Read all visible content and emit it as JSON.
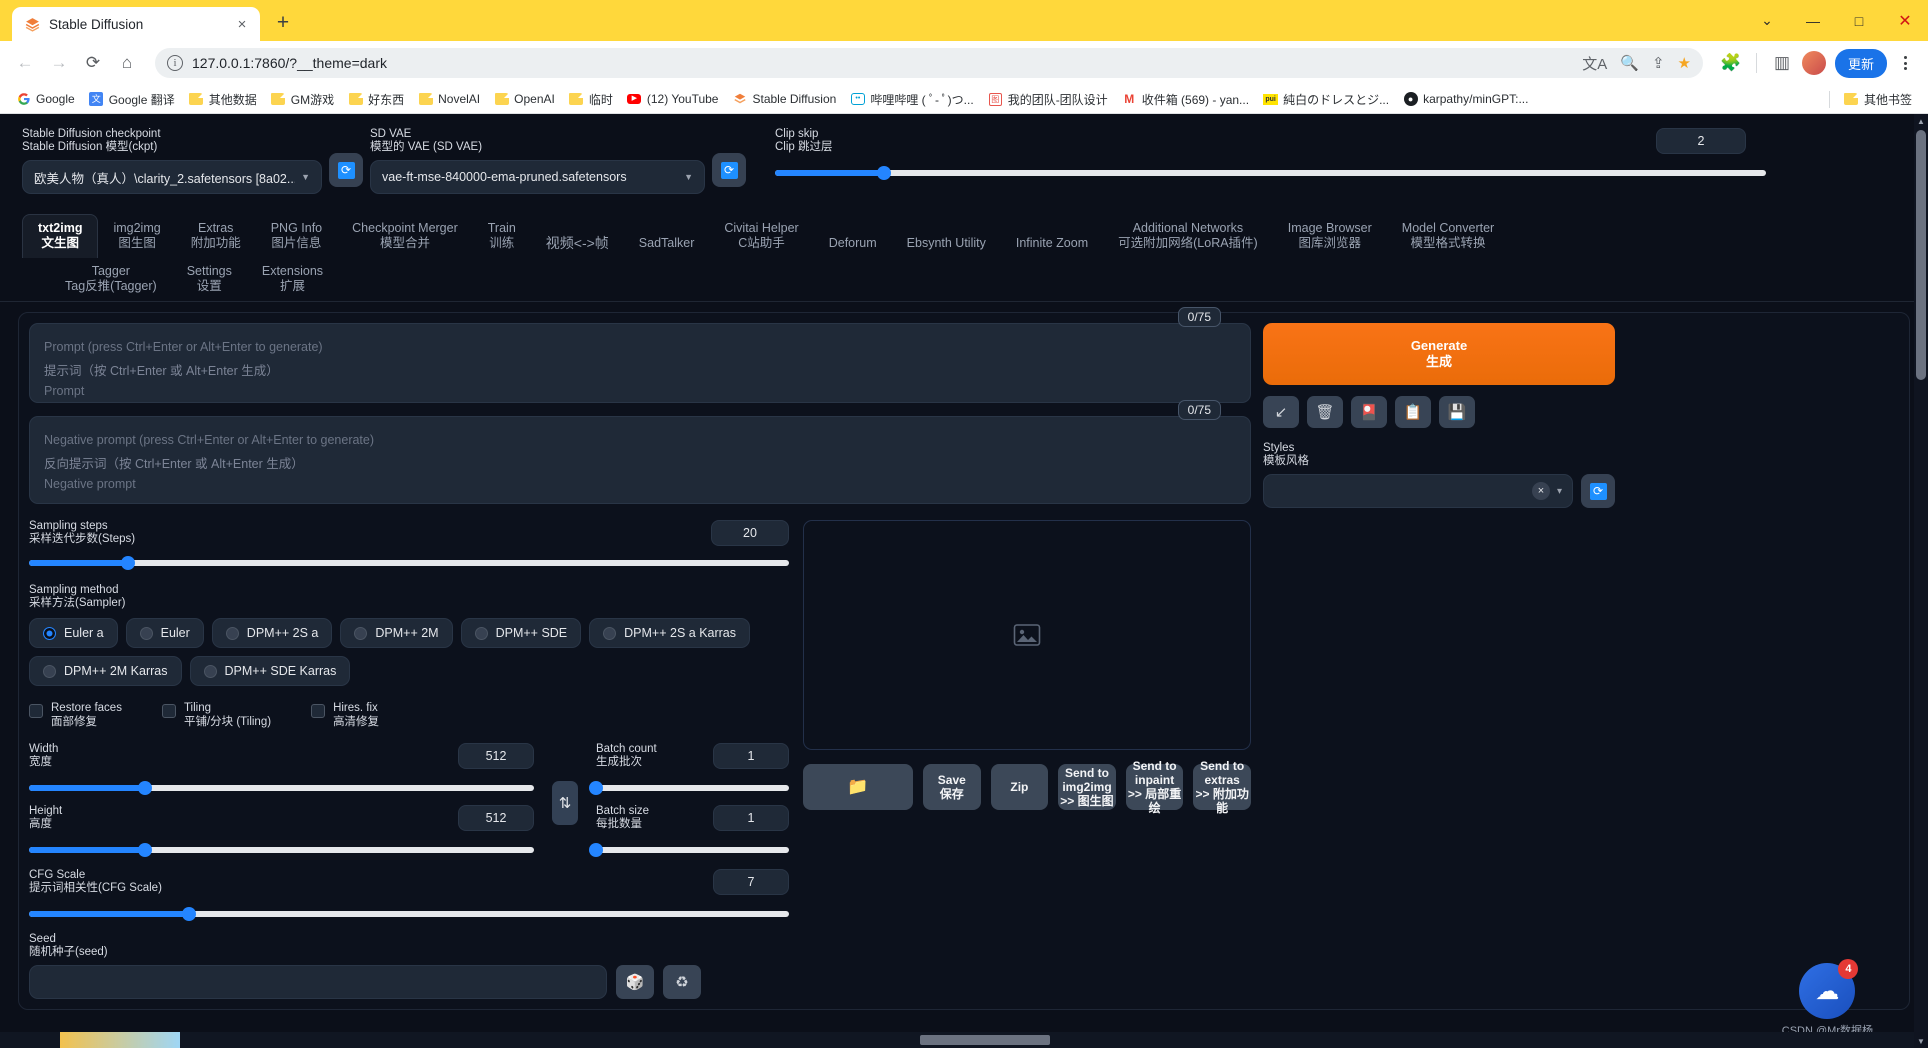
{
  "browser": {
    "tab": {
      "title": "Stable Diffusion",
      "favicon": "stable-diffusion-icon",
      "close": "×"
    },
    "newtab": "+",
    "window": {
      "minimize": "—",
      "maximize": "□",
      "restore": "⌄",
      "close": "✕"
    },
    "nav": {
      "back": "←",
      "forward": "→",
      "reload": "⟳",
      "home": "⌂"
    },
    "omnibox": {
      "url": "127.0.0.1:7860/?__theme=dark",
      "info_icon": "i",
      "translate_icon": "translate-icon",
      "zoom_icon": "zoom-icon",
      "share_icon": "share-icon",
      "star_icon": "★"
    },
    "navright": {
      "extensions": "extensions-icon",
      "sidepanel": "side-panel-icon",
      "profile": "avatar",
      "update_label": "更新",
      "menu": "kebab-menu-icon"
    },
    "bookmarks": [
      {
        "label": "Google",
        "icon": "google-icon"
      },
      {
        "label": "Google 翻译",
        "icon": "google-translate-icon"
      },
      {
        "label": "其他数据",
        "icon": "folder-icon"
      },
      {
        "label": "GM游戏",
        "icon": "folder-icon"
      },
      {
        "label": "好东西",
        "icon": "folder-icon"
      },
      {
        "label": "NovelAI",
        "icon": "folder-icon"
      },
      {
        "label": "OpenAI",
        "icon": "folder-icon"
      },
      {
        "label": "临时",
        "icon": "folder-icon"
      },
      {
        "label": "(12) YouTube",
        "icon": "youtube-icon"
      },
      {
        "label": "Stable Diffusion",
        "icon": "stable-diffusion-icon"
      },
      {
        "label": "哔哩哔哩 ( ﾟ- ﾟ)つ...",
        "icon": "bilibili-icon"
      },
      {
        "label": "我的团队-团队设计",
        "icon": "design-icon"
      },
      {
        "label": "收件箱 (569) - yan...",
        "icon": "gmail-icon"
      },
      {
        "label": "純白のドレスとジ...",
        "icon": "pixiv-icon"
      },
      {
        "label": "karpathy/minGPT:...",
        "icon": "github-icon"
      }
    ],
    "bookmarks_other": {
      "label": "其他书签",
      "icon": "folder-icon"
    }
  },
  "topbar": {
    "checkpoint": {
      "label_en": "Stable Diffusion checkpoint",
      "label_cn": "Stable Diffusion 模型(ckpt)",
      "value": "欧美人物（真人）\\clarity_2.safetensors [8a02...",
      "refresh_icon": "refresh-icon"
    },
    "vae": {
      "label_en": "SD VAE",
      "label_cn": "模型的 VAE (SD VAE)",
      "value": "vae-ft-mse-840000-ema-pruned.safetensors",
      "refresh_icon": "refresh-icon"
    },
    "clip_skip": {
      "label_en": "Clip skip",
      "label_cn": "Clip 跳过层",
      "value": "2",
      "min": 1,
      "max": 12,
      "percent": 11
    }
  },
  "tabs_row1": [
    {
      "en": "txt2img",
      "cn": "文生图",
      "active": true
    },
    {
      "en": "img2img",
      "cn": "图生图",
      "active": false
    },
    {
      "en": "Extras",
      "cn": "附加功能",
      "active": false
    },
    {
      "en": "PNG Info",
      "cn": "图片信息",
      "active": false
    },
    {
      "en": "Checkpoint Merger",
      "cn": "模型合并",
      "active": false
    },
    {
      "en": "Train",
      "cn": "训练",
      "active": false
    },
    {
      "en": "视频<->帧",
      "cn": "",
      "active": false
    },
    {
      "en": "SadTalker",
      "cn": "",
      "active": false
    },
    {
      "en": "Civitai Helper",
      "cn": "C站助手",
      "active": false
    },
    {
      "en": "Deforum",
      "cn": "",
      "active": false
    },
    {
      "en": "Ebsynth Utility",
      "cn": "",
      "active": false
    },
    {
      "en": "Infinite Zoom",
      "cn": "",
      "active": false
    },
    {
      "en": "Additional Networks",
      "cn": "可选附加网络(LoRA插件)",
      "active": false
    },
    {
      "en": "Image Browser",
      "cn": "图库浏览器",
      "active": false
    },
    {
      "en": "Model Converter",
      "cn": "模型格式转换",
      "active": false
    }
  ],
  "tabs_row2": [
    {
      "en": "Tagger",
      "cn": "Tag反推(Tagger)"
    },
    {
      "en": "Settings",
      "cn": "设置"
    },
    {
      "en": "Extensions",
      "cn": "扩展"
    }
  ],
  "prompt": {
    "placeholder_en": "Prompt (press Ctrl+Enter or Alt+Enter to generate)",
    "placeholder_cn": "提示词（按 Ctrl+Enter 或 Alt+Enter 生成）",
    "placeholder_name": "Prompt",
    "value": "",
    "counter": "0/75"
  },
  "negative_prompt": {
    "placeholder_en": "Negative prompt (press Ctrl+Enter or Alt+Enter to generate)",
    "placeholder_cn": "反向提示词（按 Ctrl+Enter 或 Alt+Enter 生成）",
    "placeholder_name": "Negative prompt",
    "value": "",
    "counter": "0/75"
  },
  "generate": {
    "en": "Generate",
    "cn": "生成"
  },
  "prompt_tools": [
    {
      "name": "arrow-down-left-icon",
      "glyph": "↙"
    },
    {
      "name": "trash-icon",
      "glyph": "🗑"
    },
    {
      "name": "paste-extra-icon",
      "glyph": "🎴"
    },
    {
      "name": "clipboard-icon",
      "glyph": "📋"
    },
    {
      "name": "save-style-icon",
      "glyph": "💾"
    }
  ],
  "styles": {
    "label_en": "Styles",
    "label_cn": "模板风格",
    "value": "",
    "clear_icon": "×",
    "dropdown_icon": "▾",
    "refresh_icon": "refresh-icon"
  },
  "sampling_steps": {
    "label_en": "Sampling steps",
    "label_cn": "采样迭代步数(Steps)",
    "value": "20",
    "min": 1,
    "max": 150,
    "percent": 13
  },
  "sampling_method": {
    "label_en": "Sampling method",
    "label_cn": "采样方法(Sampler)",
    "options": [
      {
        "label": "Euler a",
        "selected": true
      },
      {
        "label": "Euler",
        "selected": false
      },
      {
        "label": "DPM++ 2S a",
        "selected": false
      },
      {
        "label": "DPM++ 2M",
        "selected": false
      },
      {
        "label": "DPM++ SDE",
        "selected": false
      },
      {
        "label": "DPM++ 2S a Karras",
        "selected": false
      },
      {
        "label": "DPM++ 2M Karras",
        "selected": false
      },
      {
        "label": "DPM++ SDE Karras",
        "selected": false
      }
    ]
  },
  "checkboxes": [
    {
      "en": "Restore faces",
      "cn": "面部修复",
      "checked": false
    },
    {
      "en": "Tiling",
      "cn": "平铺/分块 (Tiling)",
      "checked": false
    },
    {
      "en": "Hires. fix",
      "cn": "高清修复",
      "checked": false
    }
  ],
  "width": {
    "label_en": "Width",
    "label_cn": "宽度",
    "value": "512",
    "percent": 23
  },
  "height": {
    "label_en": "Height",
    "label_cn": "高度",
    "value": "512",
    "percent": 23
  },
  "batch_count": {
    "label_en": "Batch count",
    "label_cn": "生成批次",
    "value": "1",
    "percent": 0
  },
  "batch_size": {
    "label_en": "Batch size",
    "label_cn": "每批数量",
    "value": "1",
    "percent": 0
  },
  "swap_icon": "⇅",
  "cfg_scale": {
    "label_en": "CFG Scale",
    "label_cn": "提示词相关性(CFG Scale)",
    "value": "7",
    "percent": 21
  },
  "seed": {
    "label_en": "Seed",
    "label_cn": "随机种子(seed)",
    "value": ""
  },
  "gallery": {
    "placeholder_icon": "image-placeholder-icon"
  },
  "result_actions": [
    {
      "en": "",
      "cn": "",
      "icon": "folder-open-icon"
    },
    {
      "en": "Save",
      "cn": "保存",
      "icon": ""
    },
    {
      "en": "Zip",
      "cn": "",
      "icon": ""
    },
    {
      "en": "Send to img2img",
      "cn": ">> 图生图",
      "icon": ""
    },
    {
      "en": "Send to inpaint",
      "cn": ">> 局部重绘",
      "icon": ""
    },
    {
      "en": "Send to extras",
      "cn": ">> 附加功能",
      "icon": ""
    }
  ],
  "csdn": {
    "badge": "4",
    "text": "CSDN @Mr数据杨",
    "icon": "cloud-upload-icon"
  }
}
